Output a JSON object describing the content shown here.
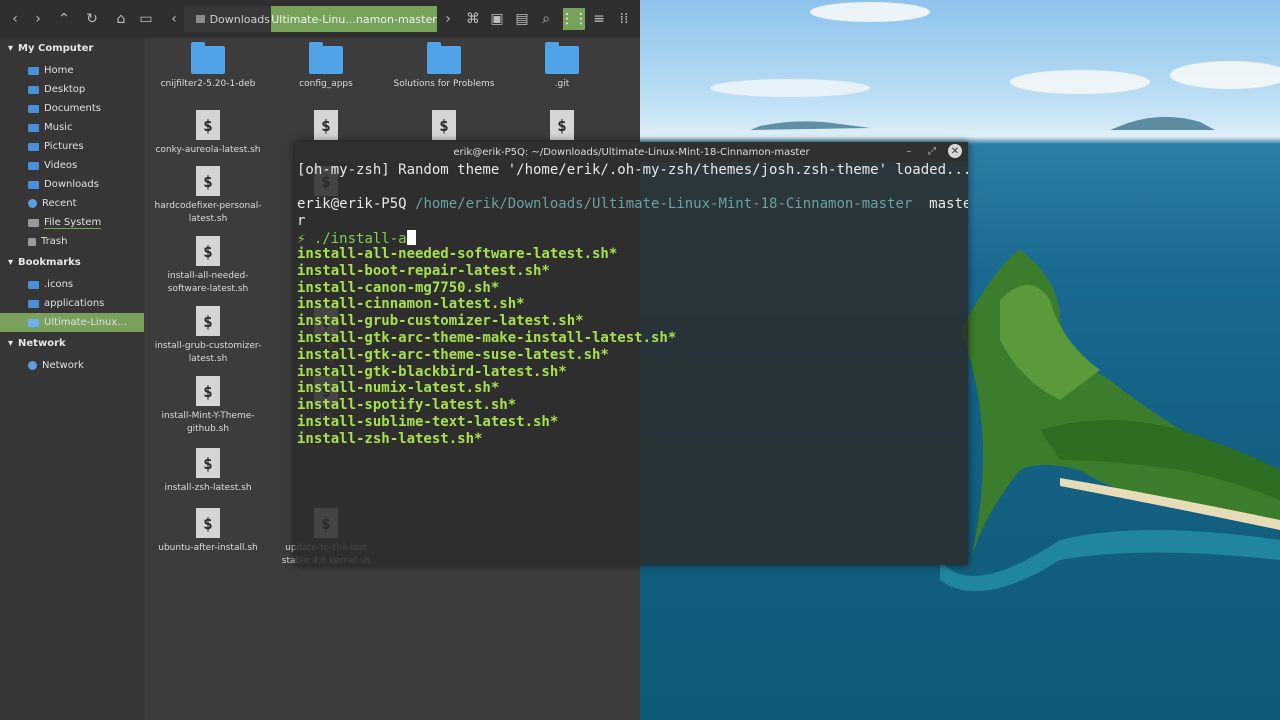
{
  "file_manager": {
    "toolbar": {
      "path_segments": [
        "Downloads",
        "Ultimate-Linu...namon-master"
      ],
      "icons": [
        "back-icon",
        "forward-icon",
        "up-icon",
        "reload-icon",
        "home-icon",
        "computer-icon",
        "terminal-icon",
        "folder-icon",
        "search-icon",
        "grid-view-icon",
        "list-view-icon",
        "compact-view-icon"
      ]
    },
    "sidebar": {
      "my_computer": {
        "header": "My Computer",
        "items": [
          "Home",
          "Desktop",
          "Documents",
          "Music",
          "Pictures",
          "Videos",
          "Downloads",
          "Recent",
          "File System",
          "Trash"
        ]
      },
      "bookmarks": {
        "header": "Bookmarks",
        "items": [
          ".icons",
          "applications",
          "Ultimate-Linux..."
        ]
      },
      "network": {
        "header": "Network",
        "items": [
          "Network"
        ]
      }
    },
    "files": [
      {
        "name": "cnijfilter2-5.20-1-deb",
        "type": "folder"
      },
      {
        "name": "config_apps",
        "type": "folder"
      },
      {
        "name": "Solutions for Problems",
        "type": "folder"
      },
      {
        "name": ".git",
        "type": "folder"
      },
      {
        "name": "conky-aureola-latest.sh",
        "type": "script"
      },
      {
        "name": "conk",
        "type": "script"
      },
      {
        "name": "",
        "type": "script"
      },
      {
        "name": "",
        "type": "script"
      },
      {
        "name": "hardcodefixer-personal-\nlatest.sh",
        "type": "script"
      },
      {
        "name": "ico",
        "type": "script"
      },
      {
        "name": "install-all-needed-\nsoftware-latest.sh",
        "type": "script"
      },
      {
        "name": "install-grub-customizer-\nlatest.sh",
        "type": "script"
      },
      {
        "name": "ins\nma",
        "type": "script"
      },
      {
        "name": "install-Mint-Y-Theme-\ngithub.sh",
        "type": "script"
      },
      {
        "name": "ins",
        "type": "script"
      },
      {
        "name": "install-zsh-latest.sh",
        "type": "script"
      },
      {
        "name": "ubuntu-after-install.sh",
        "type": "script"
      },
      {
        "name": "update-to-the-last\nstable 4.6 kernel.sh",
        "type": "script"
      }
    ]
  },
  "terminal": {
    "title": "erik@erik-P5Q: ~/Downloads/Ultimate-Linux-Mint-18-Cinnamon-master",
    "controls": [
      "minimize-icon",
      "maximize-icon",
      "close-icon"
    ],
    "loaded_line": "[oh-my-zsh] Random theme '/home/erik/.oh-my-zsh/themes/josh.zsh-theme' loaded...",
    "prompt_user": "erik@erik-P5Q",
    "prompt_path": "/home/erik/Downloads/Ultimate-Linux-Mint-18-Cinnamon-master",
    "prompt_branch": "maste",
    "prompt_wrap": "r",
    "prompt_symbol": "⚡",
    "command": "./install-a",
    "completions": [
      "install-all-needed-software-latest.sh*",
      "install-boot-repair-latest.sh*",
      "install-canon-mg7750.sh*",
      "install-cinnamon-latest.sh*",
      "install-grub-customizer-latest.sh*",
      "install-gtk-arc-theme-make-install-latest.sh*",
      "install-gtk-arc-theme-suse-latest.sh*",
      "install-gtk-blackbird-latest.sh*",
      "install-numix-latest.sh*",
      "install-spotify-latest.sh*",
      "install-sublime-text-latest.sh*",
      "install-zsh-latest.sh*"
    ]
  },
  "colors": {
    "accent_green": "#78a15a",
    "folder_blue": "#4fa3e6",
    "terminal_green": "#a7e14c"
  }
}
